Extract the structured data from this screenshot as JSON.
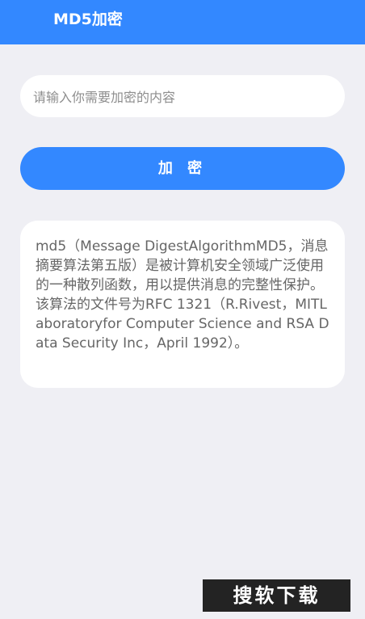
{
  "app_bar": {
    "title": "MD5加密",
    "color": "#3388ff"
  },
  "input": {
    "placeholder": "请输入你需要加密的内容",
    "value": ""
  },
  "encrypt_button": {
    "label": "加 密"
  },
  "description": {
    "text": "md5（Message DigestAlgorithmMD5，消息摘要算法第五版）是被计算机安全领域广泛使用的一种散列函数，用以提供消息的完整性保护。该算法的文件号为RFC 1321（R.Rivest，MITLaboratoryfor Computer Science and RSA Data Security Inc，April 1992）。"
  },
  "watermark": {
    "text": "搜软下载"
  }
}
